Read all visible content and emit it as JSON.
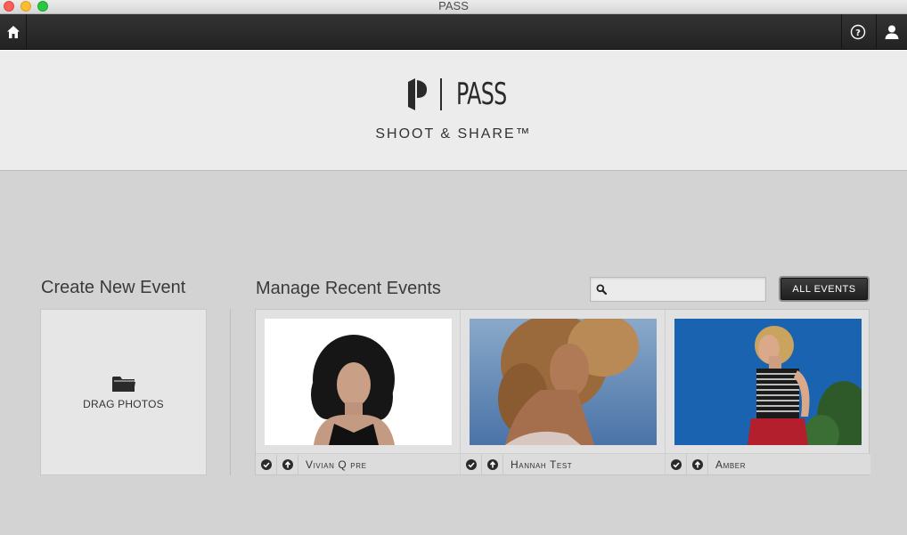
{
  "window": {
    "title": "PASS"
  },
  "toolbar": {
    "home_icon": "home-icon",
    "help_icon": "help-icon",
    "user_icon": "user-icon"
  },
  "header": {
    "logo_text": "PASS",
    "tagline": "SHOOT & SHARE™"
  },
  "create": {
    "title": "Create New Event",
    "drop_label": "DRAG PHOTOS",
    "drop_icon": "folder-icon"
  },
  "manage": {
    "title": "Manage Recent Events",
    "search_placeholder": "",
    "search_value": "",
    "all_events_label": "ALL EVENTS",
    "events": [
      {
        "name": "Vivian Q pre"
      },
      {
        "name": "Hannah Test"
      },
      {
        "name": "Amber"
      }
    ]
  },
  "colors": {
    "toolbar": "#2a2a2a",
    "header_bg": "#ececec",
    "main_bg": "#d3d3d3"
  }
}
